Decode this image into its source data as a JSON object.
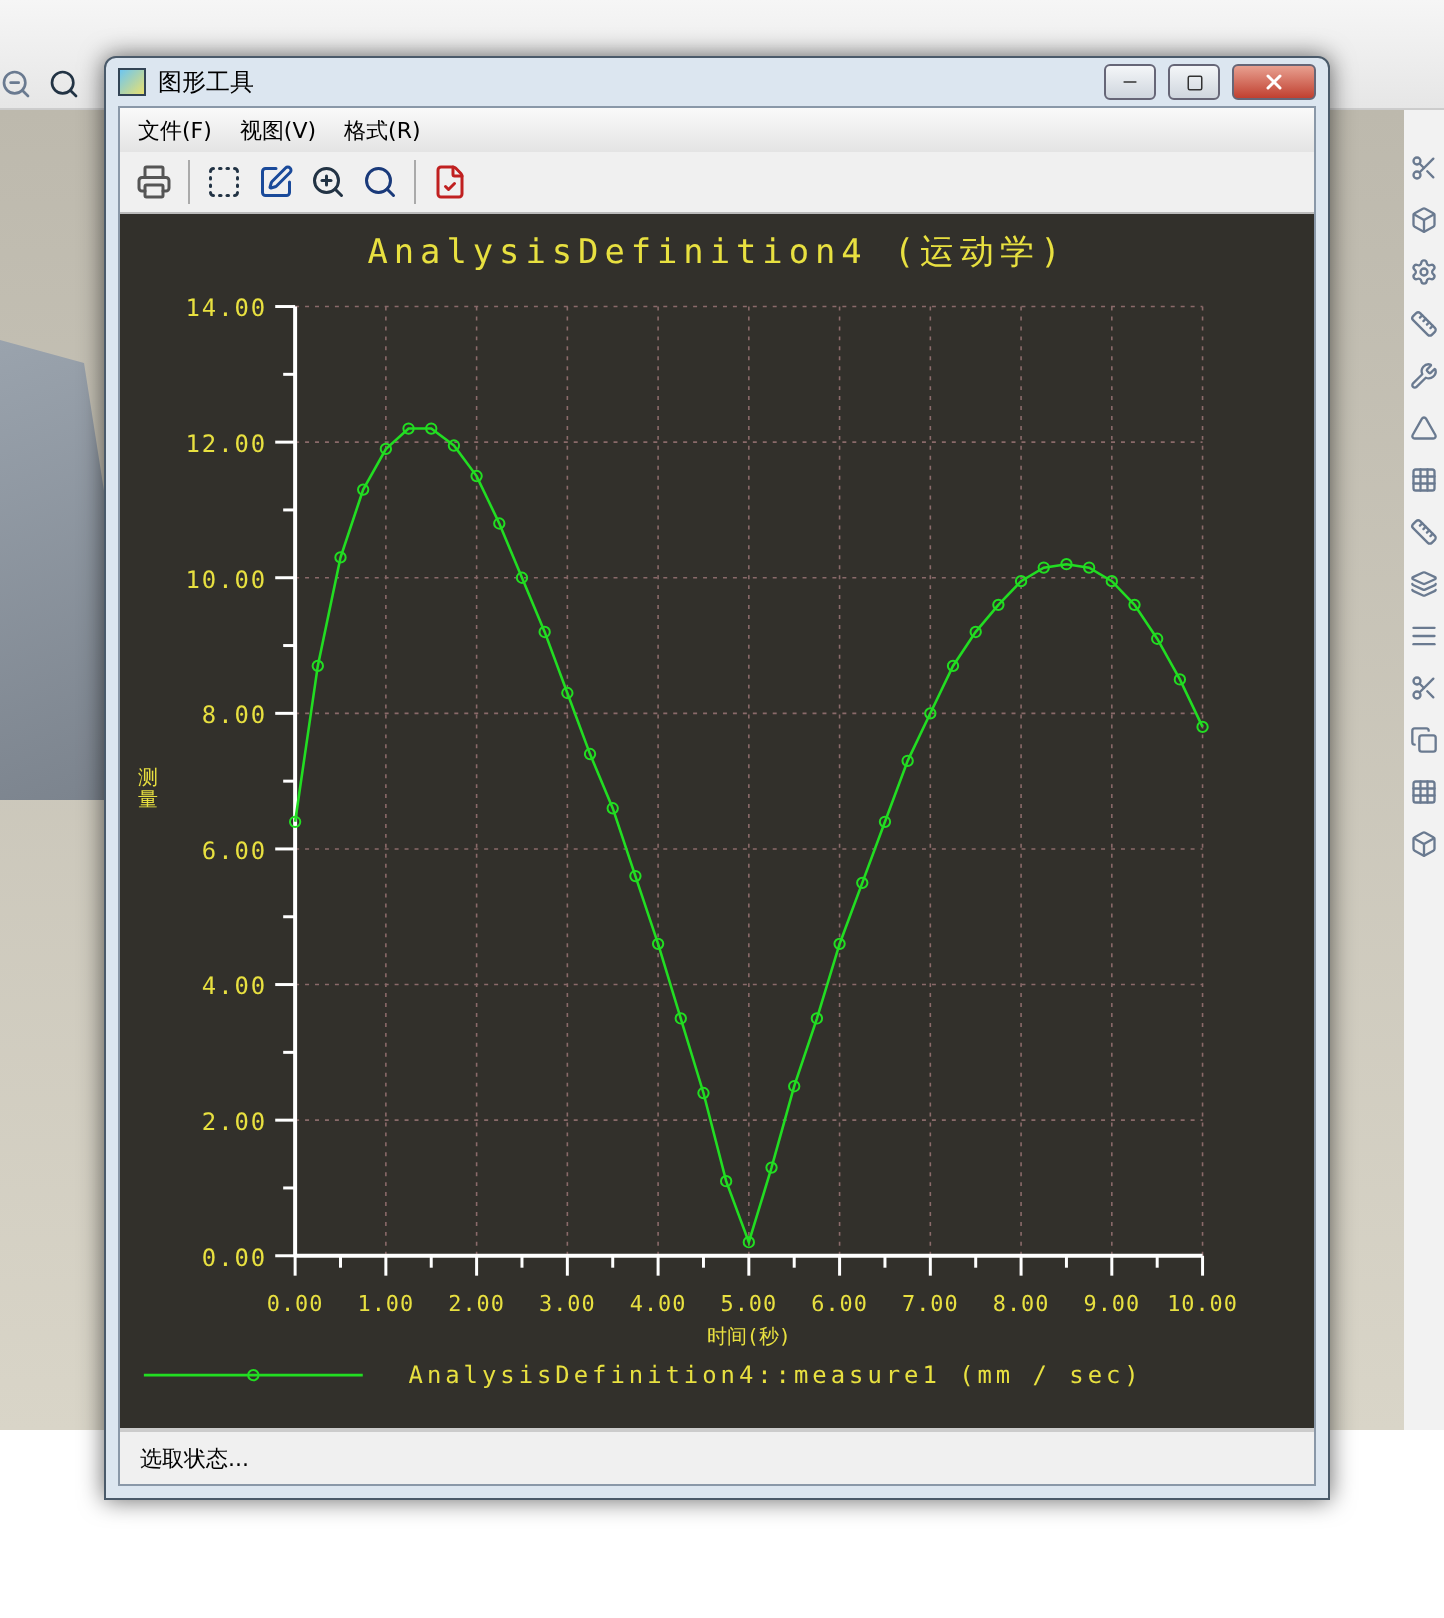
{
  "window": {
    "title": "图形工具"
  },
  "menu": [
    {
      "label": "文件(F)"
    },
    {
      "label": "视图(V)"
    },
    {
      "label": "格式(R)"
    }
  ],
  "chart": {
    "chart_data": {
      "type": "line",
      "title": "AnalysisDefinition4 (运动学)",
      "xlabel": "时间(秒)",
      "ylabel": "测量",
      "x": [
        0,
        0.25,
        0.5,
        0.75,
        1,
        1.25,
        1.5,
        1.75,
        2,
        2.25,
        2.5,
        2.75,
        3,
        3.25,
        3.5,
        3.75,
        4,
        4.25,
        4.5,
        4.75,
        5,
        5.25,
        5.5,
        5.75,
        6,
        6.25,
        6.5,
        6.75,
        7,
        7.25,
        7.5,
        7.75,
        8,
        8.25,
        8.5,
        8.75,
        9,
        9.25,
        9.5,
        9.75,
        10
      ],
      "series": [
        {
          "name": "AnalysisDefinition4::measure1 (mm / sec)",
          "color": "#22dd22",
          "marker": "circle",
          "values": [
            6.4,
            8.7,
            10.3,
            11.3,
            11.9,
            12.2,
            12.2,
            11.95,
            11.5,
            10.8,
            10.0,
            9.2,
            8.3,
            7.4,
            6.6,
            5.6,
            4.6,
            3.5,
            2.4,
            1.1,
            0.2,
            1.3,
            2.5,
            3.5,
            4.6,
            5.5,
            6.4,
            7.3,
            8.0,
            8.7,
            9.2,
            9.6,
            9.95,
            10.15,
            10.2,
            10.15,
            9.95,
            9.6,
            9.1,
            8.5,
            7.8
          ]
        }
      ],
      "grid": true,
      "xlim": [
        0,
        10
      ],
      "ylim": [
        0,
        14
      ],
      "xticks": [
        {
          "value": 0,
          "label": "0.00"
        },
        {
          "value": 1,
          "label": "1.00"
        },
        {
          "value": 2,
          "label": "2.00"
        },
        {
          "value": 3,
          "label": "3.00"
        },
        {
          "value": 4,
          "label": "4.00"
        },
        {
          "value": 5,
          "label": "5.00"
        },
        {
          "value": 6,
          "label": "6.00"
        },
        {
          "value": 7,
          "label": "7.00"
        },
        {
          "value": 8,
          "label": "8.00"
        },
        {
          "value": 9,
          "label": "9.00"
        },
        {
          "value": 10,
          "label": "10.00"
        }
      ],
      "yticks": [
        {
          "value": 0,
          "label": "0.00"
        },
        {
          "value": 2,
          "label": "2.00"
        },
        {
          "value": 4,
          "label": "4.00"
        },
        {
          "value": 6,
          "label": "6.00"
        },
        {
          "value": 8,
          "label": "8.00"
        },
        {
          "value": 10,
          "label": "10.00"
        },
        {
          "value": 12,
          "label": "12.00"
        },
        {
          "value": 14,
          "label": "14.00"
        }
      ]
    }
  },
  "status_bar": {
    "text": "选取状态..."
  }
}
